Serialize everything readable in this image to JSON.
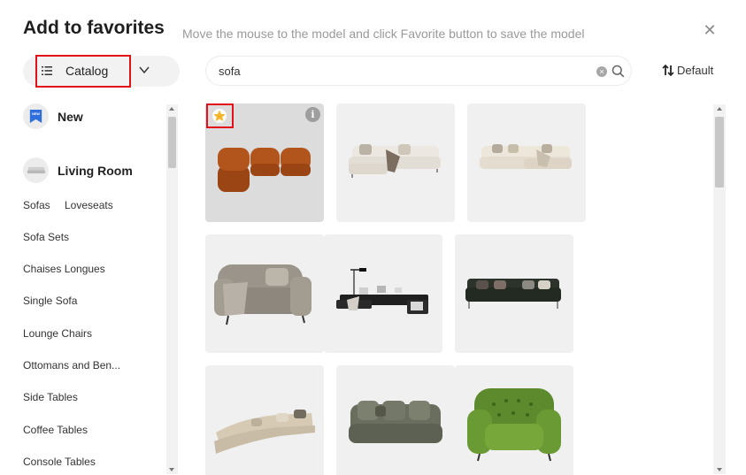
{
  "dialog": {
    "title": "Add to favorites",
    "subtitle": "Move the mouse to the model and click Favorite button to save the model",
    "close_glyph": "✕"
  },
  "catalog": {
    "label": "Catalog",
    "icon": "list-icon",
    "dropdown_icon": "chevron-down-icon"
  },
  "search": {
    "value": "sofa",
    "clear_icon": "clear-icon",
    "search_icon": "search-icon"
  },
  "sort": {
    "label": "Default",
    "icon": "sort-icon"
  },
  "sidebar": {
    "categories": [
      {
        "label": "New",
        "icon": "new-badge-icon"
      },
      {
        "label": "Living Room",
        "icon": "sofa-thumbnail"
      }
    ],
    "links": [
      "Sofas",
      "Loveseats",
      "Sofa Sets",
      "Chaises Longues",
      "Single Sofa",
      "Lounge Chairs",
      "Ottomans and Ben...",
      "Side Tables",
      "Coffee Tables",
      "Console Tables"
    ]
  },
  "grid": {
    "items": [
      {
        "name": "rust modular sofa",
        "color": "#a24c1c",
        "selected": true
      },
      {
        "name": "white sectional sofa",
        "color": "#e7e3dc"
      },
      {
        "name": "cream sectional sofa",
        "color": "#e4ddd2"
      },
      {
        "name": "gray armchair",
        "color": "#8f8a82"
      },
      {
        "name": "black low sofa with lamp",
        "color": "#222222"
      },
      {
        "name": "dark green sofa",
        "color": "#2b3328"
      },
      {
        "name": "curved beige sofa",
        "color": "#d9cfbc"
      },
      {
        "name": "olive sofa",
        "color": "#6e7263"
      },
      {
        "name": "green tufted armchair",
        "color": "#5f8a2f"
      }
    ],
    "favorite_icon": "star-icon",
    "info_icon": "info-icon",
    "info_glyph": "i",
    "accent_color": "#f5b52a",
    "highlight_color": "#e3101a"
  }
}
